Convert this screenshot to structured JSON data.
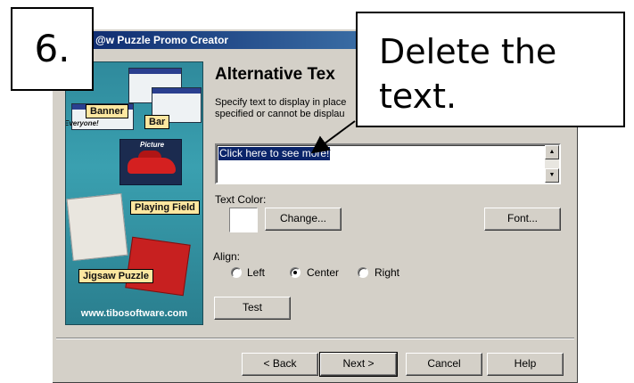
{
  "window": {
    "title": "@w Puzzle Promo Creator"
  },
  "sidebar": {
    "tags": [
      "Banner",
      "Bar",
      "Playing Field",
      "Jigsaw Puzzle"
    ],
    "everyone_text": "Everyone!",
    "url": "www.tibosoftware.com",
    "picture_label": "Picture"
  },
  "page": {
    "heading": "Alternative Tex",
    "description": "Specify text to display in place\nspecified or cannot be displau"
  },
  "text_box": {
    "value": "Click here to see more!"
  },
  "color": {
    "label": "Text Color:",
    "change_button": "Change...",
    "font_button": "Font..."
  },
  "align": {
    "label": "Align:",
    "options": [
      "Left",
      "Center",
      "Right"
    ],
    "selected": "Center"
  },
  "test_button": "Test",
  "nav": {
    "back": "< Back",
    "next": "Next >",
    "cancel": "Cancel",
    "help": "Help"
  },
  "annotation": {
    "step": "6.",
    "note": "Delete the text."
  }
}
